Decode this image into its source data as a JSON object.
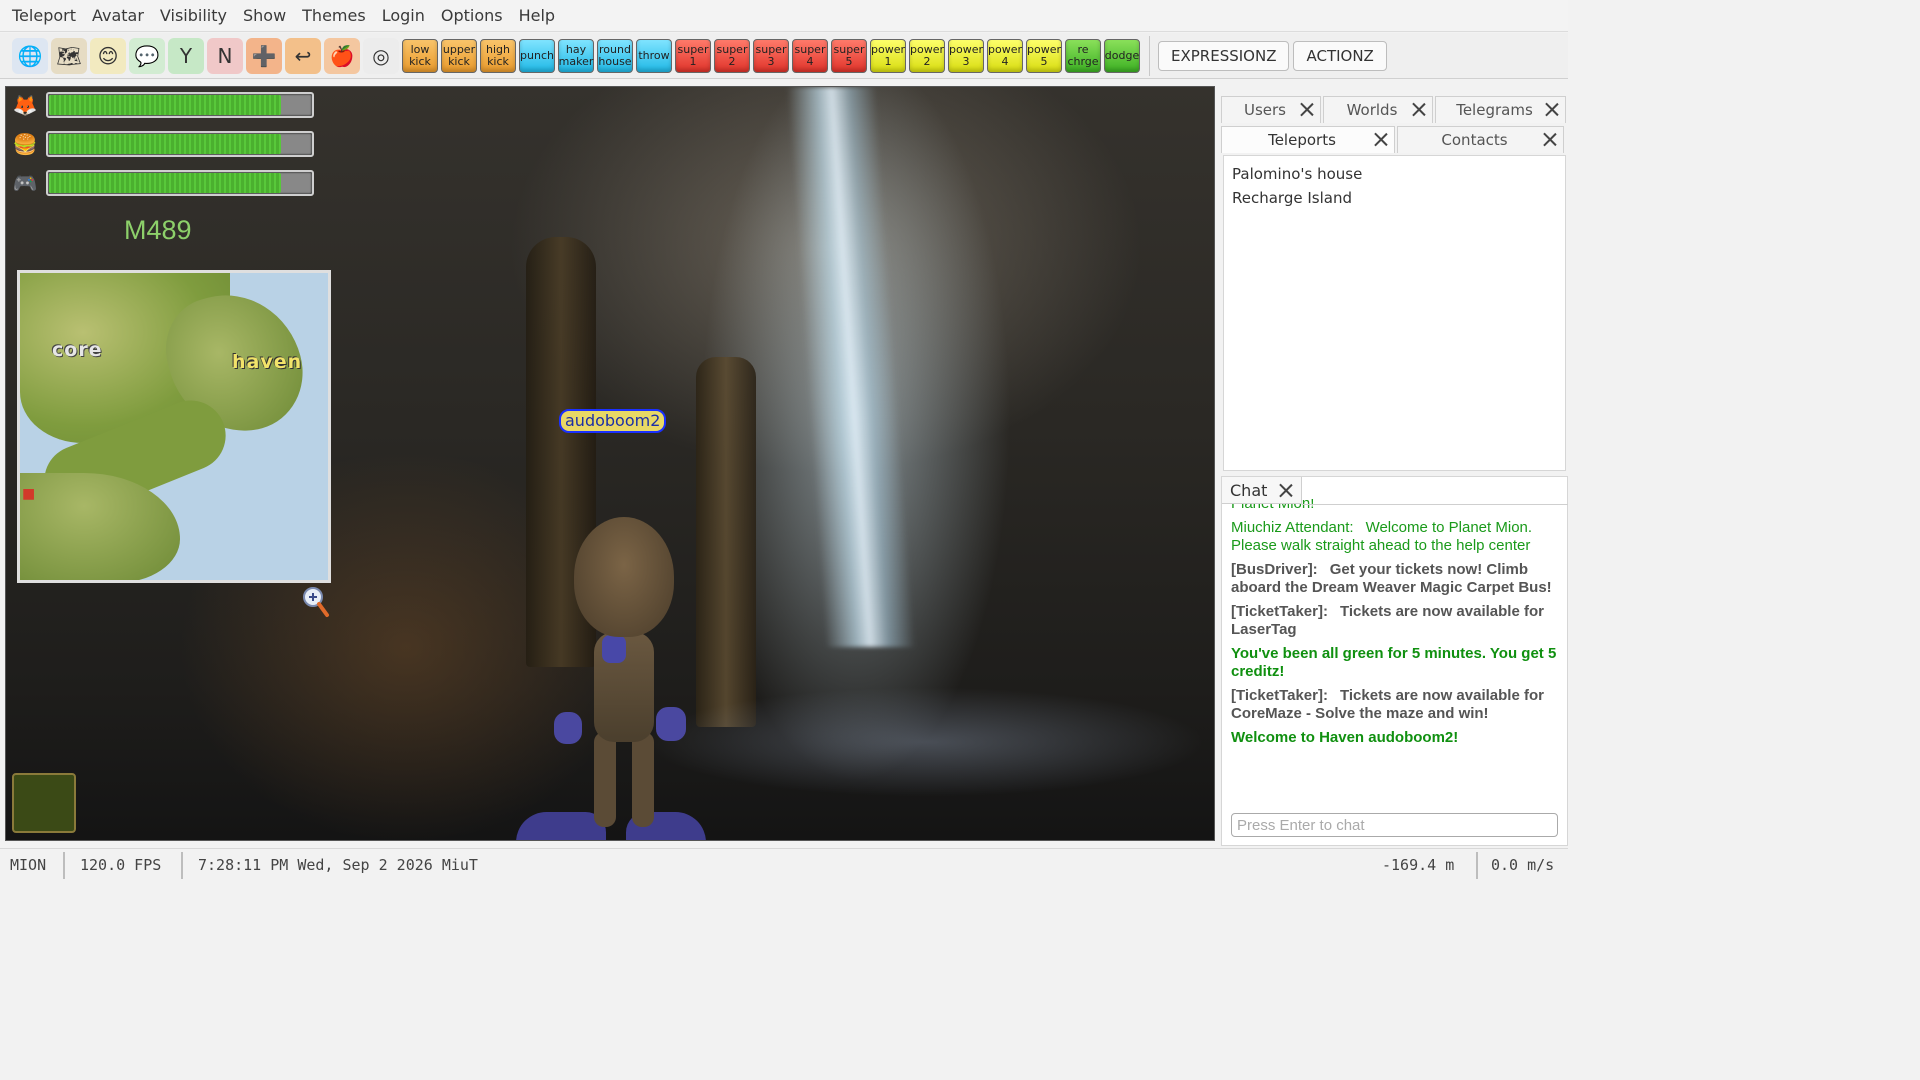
{
  "menu": [
    "Teleport",
    "Avatar",
    "Visibility",
    "Show",
    "Themes",
    "Login",
    "Options",
    "Help"
  ],
  "toolbar": {
    "icons": [
      {
        "name": "globe-icon",
        "glyph": "🌐",
        "bg": "#dde6f2"
      },
      {
        "name": "map-icon",
        "glyph": "🗺",
        "bg": "#e6dcc4"
      },
      {
        "name": "smiley-icon",
        "glyph": "😊",
        "bg": "#f2eac0"
      },
      {
        "name": "chat-bubble-icon",
        "glyph": "💬",
        "bg": "#d2ecd2"
      },
      {
        "name": "yes-icon",
        "glyph": "Y",
        "bg": "#c6e8c6"
      },
      {
        "name": "no-icon",
        "glyph": "N",
        "bg": "#f0c8c8"
      },
      {
        "name": "teleport-add-icon",
        "glyph": "➕",
        "bg": "#f3b48a"
      },
      {
        "name": "teleport-back-icon",
        "glyph": "↩",
        "bg": "#f3c08a"
      },
      {
        "name": "apple-icon",
        "glyph": "🍎",
        "bg": "#f4c7a0"
      },
      {
        "name": "target-icon",
        "glyph": "◎",
        "bg": "#ececec"
      }
    ],
    "actions": [
      {
        "label": "low kick",
        "color": "orange",
        "name": "low-kick-button"
      },
      {
        "label": "upper kick",
        "color": "orange",
        "name": "upper-kick-button"
      },
      {
        "label": "high kick",
        "color": "orange",
        "name": "high-kick-button"
      },
      {
        "label": "punch",
        "color": "cyan",
        "name": "punch-button"
      },
      {
        "label": "hay maker",
        "color": "cyan",
        "name": "hay-maker-button"
      },
      {
        "label": "round house",
        "color": "cyan",
        "name": "round-house-button"
      },
      {
        "label": "throw",
        "color": "cyan",
        "name": "throw-button"
      },
      {
        "label": "super 1",
        "color": "red",
        "name": "super-1-button"
      },
      {
        "label": "super 2",
        "color": "red",
        "name": "super-2-button"
      },
      {
        "label": "super 3",
        "color": "red",
        "name": "super-3-button"
      },
      {
        "label": "super 4",
        "color": "red",
        "name": "super-4-button"
      },
      {
        "label": "super 5",
        "color": "red",
        "name": "super-5-button"
      },
      {
        "label": "power 1",
        "color": "yellow",
        "name": "power-1-button"
      },
      {
        "label": "power 2",
        "color": "yellow",
        "name": "power-2-button"
      },
      {
        "label": "power 3",
        "color": "yellow",
        "name": "power-3-button"
      },
      {
        "label": "power 4",
        "color": "yellow",
        "name": "power-4-button"
      },
      {
        "label": "power 5",
        "color": "yellow",
        "name": "power-5-button"
      },
      {
        "label": "re chrge",
        "color": "green",
        "name": "recharge-button"
      },
      {
        "label": "dodge",
        "color": "green",
        "name": "dodge-button"
      }
    ],
    "expressionz_label": "EXPRESSIONZ",
    "actionz_label": "ACTIONZ"
  },
  "hud": {
    "bars": [
      {
        "icon": "fox-icon",
        "glyph": "🦊",
        "level": 0.88
      },
      {
        "icon": "burger-icon",
        "glyph": "🍔",
        "level": 0.88
      },
      {
        "icon": "gamepad-icon",
        "glyph": "🎮",
        "level": 0.88
      }
    ],
    "zone": "M489"
  },
  "minimap": {
    "labels": [
      "core",
      "haven"
    ]
  },
  "avatar_nametag": "audoboom2",
  "panel": {
    "tabs_row1": [
      "Users",
      "Worlds",
      "Telegrams"
    ],
    "tabs_row2": [
      "Teleports",
      "Contacts"
    ],
    "teleports": [
      "Palomino's house",
      "Recharge Island"
    ]
  },
  "chat": {
    "tab_label": "Chat",
    "partial_top": "Planet Mion!",
    "messages": [
      {
        "who": "Miuchiz Attendant:",
        "text": "Welcome to Planet Mion.  Please walk straight ahead to the help center",
        "style": "c-green"
      },
      {
        "who": "[BusDriver]:",
        "text": "Get your tickets now! Climb aboard the Dream Weaver Magic Carpet Bus!",
        "style": "c-dark"
      },
      {
        "who": "[TicketTaker]:",
        "text": "Tickets are now available for LaserTag",
        "style": "c-dark"
      },
      {
        "who": "",
        "text": "You've been all green for 5 minutes. You get 5 creditz!",
        "style": "c-bold-green"
      },
      {
        "who": "[TicketTaker]:",
        "text": "Tickets are now available for CoreMaze - Solve the maze and win!",
        "style": "c-dark"
      },
      {
        "who": "",
        "text": "Welcome to Haven audoboom2!",
        "style": "c-bold-green"
      }
    ],
    "placeholder": "Press Enter to chat"
  },
  "status": {
    "app": "MION",
    "fps": "120.0 FPS",
    "time": "7:28:11 PM Wed, Sep 2 2026 MiuT",
    "altitude": "-169.4 m",
    "speed": "0.0 m/s"
  }
}
